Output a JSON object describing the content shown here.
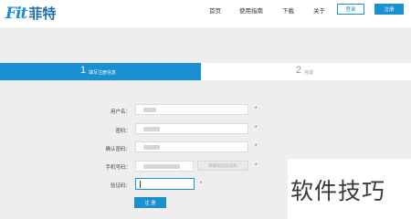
{
  "brand": {
    "logo_latin": "Fit",
    "logo_cn": "菲特",
    "accent": "#1a8fd1"
  },
  "nav": {
    "home": "首页",
    "guide": "使用指南",
    "download": "下载",
    "about": "关于"
  },
  "auth": {
    "login": "登录",
    "register": "注册"
  },
  "steps": [
    {
      "number": "1",
      "label": "填写注册信息",
      "active": true
    },
    {
      "number": "2",
      "label": "完成",
      "active": false
    }
  ],
  "form": {
    "username_label": "用户名：",
    "password_label": "密码：",
    "confirm_password_label": "确认密码：",
    "phone_label": "手机号码：",
    "captcha_label": "验证码：",
    "required_mark": "*",
    "send_code_button": "获取短信验证码",
    "submit": "注 册"
  },
  "watermark": "软件技巧"
}
